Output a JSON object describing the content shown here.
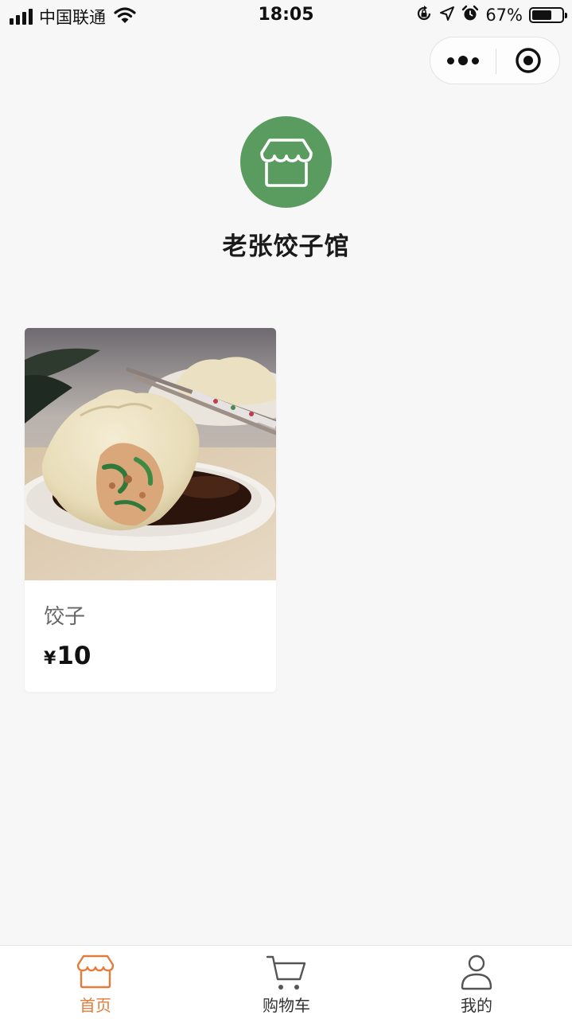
{
  "status_bar": {
    "carrier": "中国联通",
    "time": "18:05",
    "battery_percent": "67%",
    "battery_level": 0.67,
    "icons": [
      "signal-icon",
      "wifi-icon",
      "rotation-lock-icon",
      "location-arrow-icon",
      "alarm-icon",
      "battery-icon"
    ]
  },
  "capsule": {
    "icons": [
      "more-dots-icon",
      "close-target-icon"
    ]
  },
  "shop": {
    "name": "老张饺子馆",
    "logo_icon": "storefront-icon",
    "logo_color": "#5a9b5f"
  },
  "products": [
    {
      "name": "饺子",
      "currency": "¥",
      "price": "10",
      "image": "dumpling-photo"
    }
  ],
  "tab_bar": {
    "active_color": "#e37c39",
    "tabs": [
      {
        "label": "首页",
        "icon": "store-icon",
        "active": true
      },
      {
        "label": "购物车",
        "icon": "cart-icon",
        "active": false
      },
      {
        "label": "我的",
        "icon": "user-icon",
        "active": false
      }
    ]
  }
}
